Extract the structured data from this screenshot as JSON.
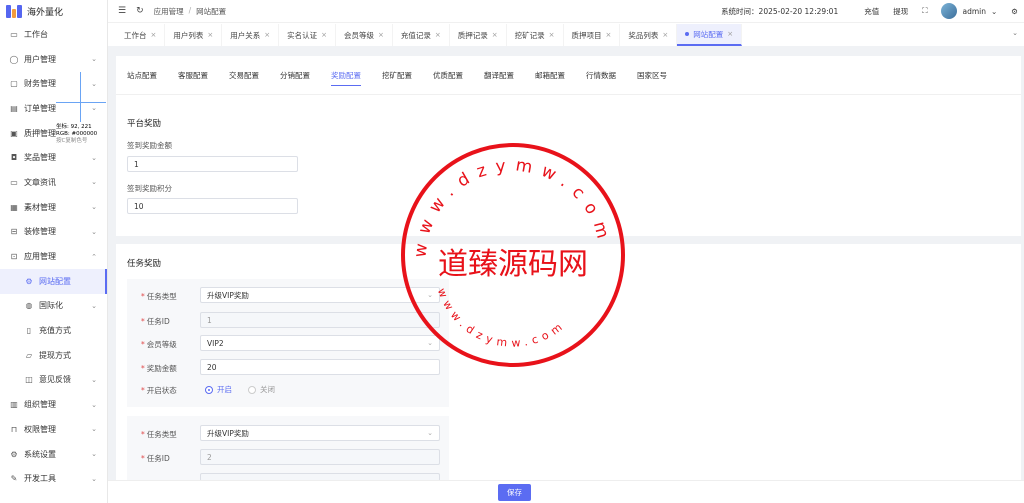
{
  "app": {
    "title": "海外量化"
  },
  "sidebar": {
    "items": [
      {
        "label": "工作台",
        "icon": "monitor-icon",
        "arrow": false
      },
      {
        "label": "用户管理",
        "icon": "user-icon",
        "arrow": true
      },
      {
        "label": "财务管理",
        "icon": "finance-icon",
        "arrow": true
      },
      {
        "label": "订单管理",
        "icon": "order-icon",
        "arrow": true
      },
      {
        "label": "质押管理",
        "icon": "pledge-icon",
        "arrow": true
      },
      {
        "label": "奖品管理",
        "icon": "gift-icon",
        "arrow": true
      },
      {
        "label": "文章资讯",
        "icon": "article-icon",
        "arrow": true
      },
      {
        "label": "素材管理",
        "icon": "material-icon",
        "arrow": true
      },
      {
        "label": "装修管理",
        "icon": "decor-icon",
        "arrow": true
      },
      {
        "label": "应用管理",
        "icon": "app-icon",
        "arrow": true
      }
    ],
    "sub_items": [
      {
        "label": "网站配置",
        "icon": "gear-icon",
        "active": true
      },
      {
        "label": "国际化",
        "icon": "globe-icon",
        "arrow": true
      },
      {
        "label": "充值方式",
        "icon": "recharge-icon"
      },
      {
        "label": "提现方式",
        "icon": "withdraw-icon"
      },
      {
        "label": "意见反馈",
        "icon": "feedback-icon",
        "arrow": true
      }
    ],
    "items_bottom": [
      {
        "label": "组织管理",
        "icon": "org-icon"
      },
      {
        "label": "权限管理",
        "icon": "lock-icon"
      },
      {
        "label": "系统设置",
        "icon": "settings-icon"
      },
      {
        "label": "开发工具",
        "icon": "tool-icon"
      }
    ],
    "color_overlay": {
      "line1": "坐标: 92, 221",
      "line2": "RGB: #000000",
      "line3": "按C复制色号"
    }
  },
  "header": {
    "breadcrumb": [
      "应用管理",
      "网站配置"
    ],
    "system_time_label": "系统时间：2025-02-20 12:29:01",
    "recharge": "充值",
    "withdraw": "提现",
    "user": "admin"
  },
  "tabs": [
    {
      "label": "工作台",
      "active": false
    },
    {
      "label": "用户列表",
      "active": false
    },
    {
      "label": "用户关系",
      "active": false
    },
    {
      "label": "实名认证",
      "active": false
    },
    {
      "label": "会员等级",
      "active": false
    },
    {
      "label": "充值记录",
      "active": false
    },
    {
      "label": "质押记录",
      "active": false
    },
    {
      "label": "挖矿记录",
      "active": false
    },
    {
      "label": "质押项目",
      "active": false
    },
    {
      "label": "奖品列表",
      "active": false
    },
    {
      "label": "网站配置",
      "active": true
    }
  ],
  "subtabs": [
    {
      "label": "站点配置",
      "active": false
    },
    {
      "label": "客服配置",
      "active": false
    },
    {
      "label": "交易配置",
      "active": false
    },
    {
      "label": "分销配置",
      "active": false
    },
    {
      "label": "奖励配置",
      "active": true
    },
    {
      "label": "挖矿配置",
      "active": false
    },
    {
      "label": "优质配置",
      "active": false
    },
    {
      "label": "翻译配置",
      "active": false
    },
    {
      "label": "邮箱配置",
      "active": false
    },
    {
      "label": "行情数据",
      "active": false
    },
    {
      "label": "国家区号",
      "active": false
    }
  ],
  "platform_reward": {
    "title": "平台奖励",
    "signin_amount_label": "签到奖励金额",
    "signin_amount_value": "1",
    "signin_points_label": "签到奖励积分",
    "signin_points_value": "10"
  },
  "task_reward": {
    "title": "任务奖励",
    "labels": {
      "task_type": "任务类型",
      "task_id": "任务ID",
      "member_level": "会员等级",
      "reward_amount": "奖励金额",
      "enabled": "开启状态",
      "on": "开启",
      "off": "关闭"
    },
    "tasks": [
      {
        "task_type": "升级VIP奖励",
        "task_id": "1",
        "member_level": "VIP2",
        "reward_amount": "20",
        "enabled": true
      },
      {
        "task_type": "升级VIP奖励",
        "task_id": "2"
      }
    ]
  },
  "footer": {
    "save_label": "保存"
  },
  "watermark": {
    "center_text": "道臻源码网",
    "top_text": "www.dzymw.com",
    "bottom_text": "www.dzymw.com",
    "color": "#e8121a"
  },
  "colors": {
    "accent": "#5b6cf2",
    "logo_blue": "#5566f0",
    "logo_orange": "#f39c3d"
  }
}
